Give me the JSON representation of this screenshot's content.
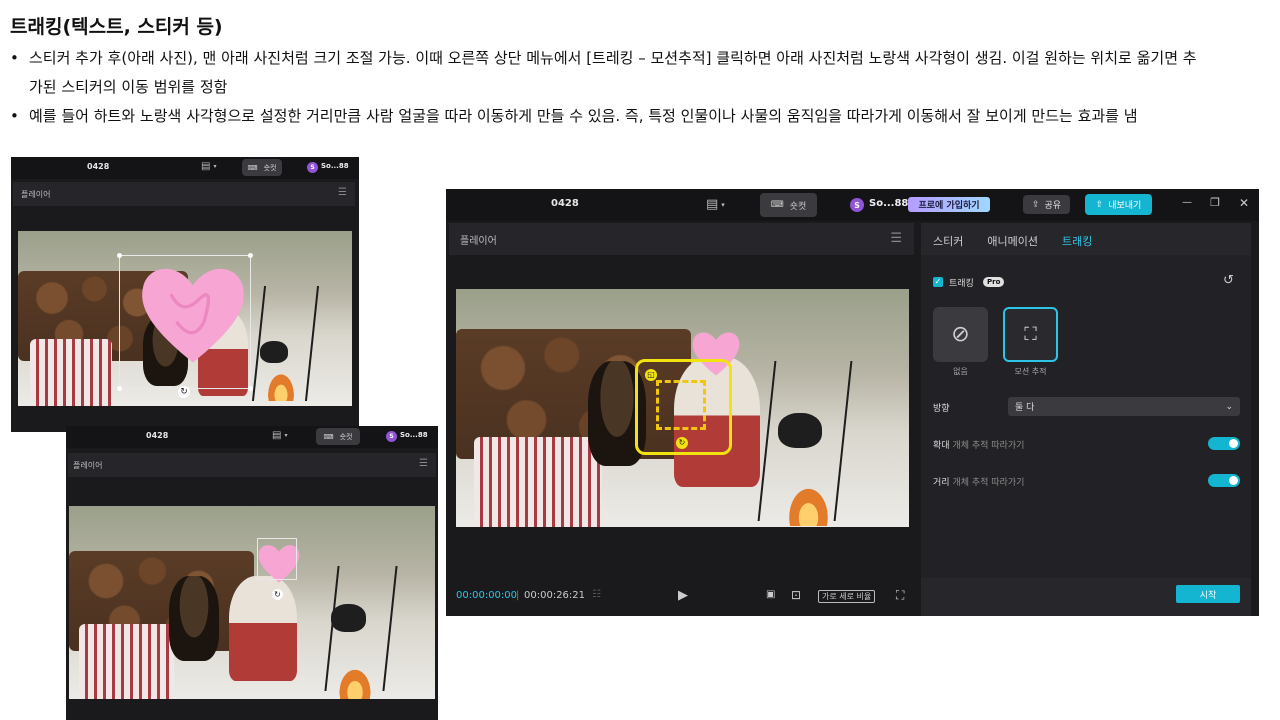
{
  "slide": {
    "title": "트래킹(텍스트, 스티커 등)",
    "bullet_marker": "•",
    "bullets": [
      "스티커 추가 후(아래 사진), 맨 아래 사진처럼 크기 조절 가능. 이때 오른쪽 상단 메뉴에서 [트레킹 – 모션추적] 클릭하면 아래 사진처럼 노랑색 사각형이 생김. 이걸 원하는 위치로 옮기면 추가된 스티커의 이동 범위를 정함",
      "예를 들어 하트와 노랑색 사각형으로 설정한 거리만큼 사람 얼굴을 따라 이동하게 만들 수 있음. 즉, 특정 인물이나 사물의 움직임을 따라가게 이동해서 잘 보이게 만드는 효과를 냄"
    ]
  },
  "app": {
    "project_name": "0428",
    "layout_icon": "▤",
    "shortcut_label": "숏컷",
    "avatar_letter": "S",
    "username": "So...88",
    "pro_label": "프로에 가입하기",
    "share_label": "공유",
    "export_label": "내보내기",
    "window_controls": [
      "—",
      "❐",
      "✕"
    ],
    "player_label": "플레이어",
    "menu_icon": "☰"
  },
  "side_panel": {
    "tabs": [
      "스티커",
      "애니메이션",
      "트래킹"
    ],
    "active_tab": "트래킹",
    "tracking_label": "트래킹",
    "pro_badge": "Pro",
    "options": [
      {
        "label": "없음",
        "icon": "ban-icon"
      },
      {
        "label": "모션 추적",
        "icon": "motion-track-icon"
      }
    ],
    "direction_label": "방향",
    "direction_value": "둘 다",
    "zoom_label": "확대",
    "zoom_sub": "개체 추적 따라가기",
    "distance_label": "거리",
    "distance_sub": "개체 추적 따라가기",
    "start_label": "시작"
  },
  "playback": {
    "current_time": "00:00:00:00",
    "separator": "|",
    "total_time": "00:00:26:21",
    "ratio_label": "가로 세로 비율"
  },
  "colors": {
    "accent": "#14b5d0",
    "tracking_box": "#f2e20f",
    "heart": "#f7a6d4"
  }
}
